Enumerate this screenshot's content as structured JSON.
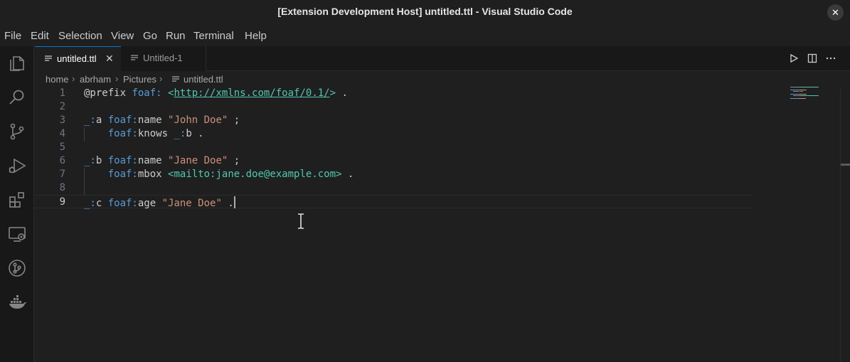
{
  "window": {
    "title": "[Extension Development Host] untitled.ttl - Visual Studio Code",
    "close_glyph": "✕"
  },
  "menu": [
    "File",
    "Edit",
    "Selection",
    "View",
    "Go",
    "Run",
    "Terminal",
    "Help"
  ],
  "activity_bar": [
    "files-icon",
    "search-icon",
    "source-control-icon",
    "run-debug-icon",
    "extensions-icon",
    "remote-explorer-icon",
    "git-graph-icon",
    "docker-icon"
  ],
  "tabs": [
    {
      "label": "untitled.ttl",
      "active": true,
      "close": "✕"
    },
    {
      "label": "Untitled-1",
      "active": false
    }
  ],
  "editor_actions": [
    "run-icon",
    "split-editor-icon",
    "more-actions-icon"
  ],
  "breadcrumb": [
    "home",
    "abrham",
    "Pictures",
    "untitled.ttl"
  ],
  "editor": {
    "lines": [
      {
        "n": "1",
        "tokens": [
          [
            "t-kw",
            "@prefix "
          ],
          [
            "t-pfx",
            "foaf: "
          ],
          [
            "t-iri",
            "<"
          ],
          [
            "t-iri-link",
            "http://xmlns.com/foaf/0.1/"
          ],
          [
            "t-iri",
            ">"
          ],
          [
            "t-punct",
            " ."
          ]
        ]
      },
      {
        "n": "2",
        "tokens": []
      },
      {
        "n": "3",
        "tokens": [
          [
            "t-blank",
            "_:"
          ],
          [
            "t-pn",
            "a "
          ],
          [
            "t-pfx",
            "foaf:"
          ],
          [
            "t-pn",
            "name "
          ],
          [
            "t-str",
            "\"John Doe\""
          ],
          [
            "t-punct",
            " ;"
          ]
        ]
      },
      {
        "n": "4",
        "tokens": [
          [
            "t-pn",
            "    "
          ],
          [
            "t-pfx",
            "foaf:"
          ],
          [
            "t-pn",
            "knows "
          ],
          [
            "t-blank",
            "_:"
          ],
          [
            "t-pn",
            "b"
          ],
          [
            "t-punct",
            " ."
          ]
        ]
      },
      {
        "n": "5",
        "tokens": []
      },
      {
        "n": "6",
        "tokens": [
          [
            "t-blank",
            "_:"
          ],
          [
            "t-pn",
            "b "
          ],
          [
            "t-pfx",
            "foaf:"
          ],
          [
            "t-pn",
            "name "
          ],
          [
            "t-str",
            "\"Jane Doe\""
          ],
          [
            "t-punct",
            " ;"
          ]
        ]
      },
      {
        "n": "7",
        "tokens": [
          [
            "t-pn",
            "    "
          ],
          [
            "t-pfx",
            "foaf:"
          ],
          [
            "t-pn",
            "mbox "
          ],
          [
            "t-iri",
            "<mailto:jane.doe@example.com>"
          ],
          [
            "t-punct",
            " ."
          ]
        ]
      },
      {
        "n": "8",
        "tokens": []
      },
      {
        "n": "9",
        "tokens": [
          [
            "t-blank",
            "_:"
          ],
          [
            "t-pn",
            "c "
          ],
          [
            "t-pfx",
            "foaf:"
          ],
          [
            "t-pn",
            "age "
          ],
          [
            "t-str",
            "\"Jane Doe\""
          ],
          [
            "t-punct",
            " ."
          ]
        ],
        "current": true
      }
    ]
  },
  "colors": {
    "accent": "#0078d4",
    "string": "#ce9178",
    "prefix": "#569cd6",
    "iri": "#4ec9b0"
  }
}
